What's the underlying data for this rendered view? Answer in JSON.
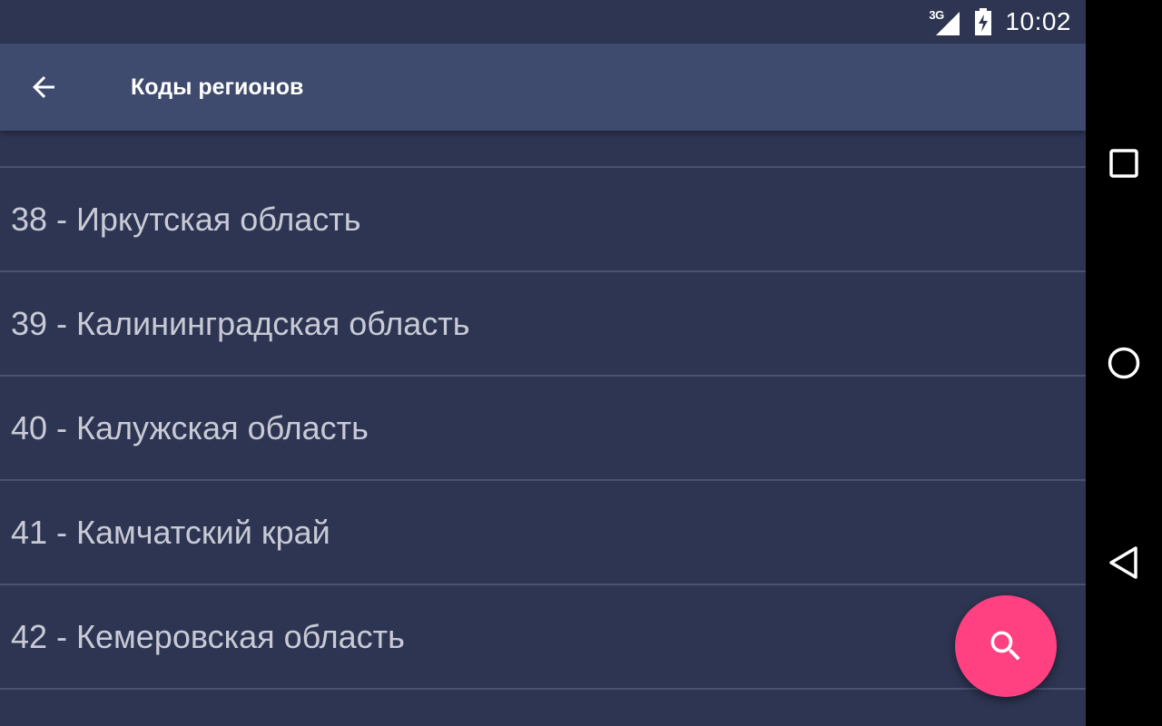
{
  "status_bar": {
    "network_label": "3G",
    "time": "10:02"
  },
  "app_bar": {
    "title": "Коды регионов",
    "back_icon": "arrow-back-icon"
  },
  "regions": [
    "38 - Иркутская область",
    "39 - Калининградская область",
    "40 - Калужская область",
    "41 - Камчатский край",
    "42 - Кемеровская область"
  ],
  "fab": {
    "icon": "search-icon",
    "color": "#ff4081"
  },
  "navigation": {
    "recents_icon": "square-recents-icon",
    "home_icon": "circle-home-icon",
    "back_icon": "triangle-back-icon"
  },
  "colors": {
    "background": "#2e3552",
    "app_bar": "#3e4a6e",
    "accent": "#ff4081"
  }
}
